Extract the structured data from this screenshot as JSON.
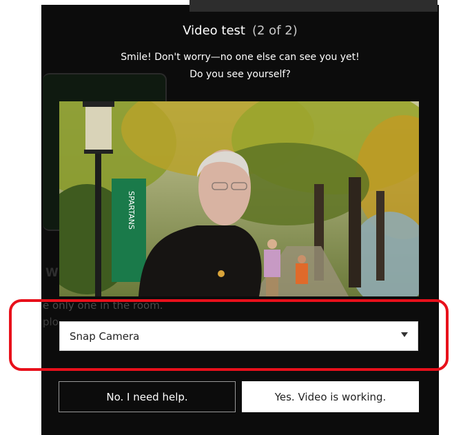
{
  "dialog": {
    "title": "Video test",
    "step": "(2 of 2)",
    "subtitle_line1": "Smile! Don't worry—no one else can see you yet!",
    "subtitle_line2": "Do you see yourself?"
  },
  "background_ui": {
    "heading_fragment": "W",
    "text_line1": "e only one in the room.",
    "text_line2": "plo"
  },
  "preview": {
    "banner_text": "SPARTANS"
  },
  "camera_select": {
    "selected": "Snap Camera"
  },
  "buttons": {
    "no_label": "No. I need help.",
    "yes_label": "Yes. Video is working."
  },
  "colors": {
    "highlight": "#e8101b",
    "modal_bg": "#0c0c0c",
    "banner_green": "#1a7a4a"
  }
}
